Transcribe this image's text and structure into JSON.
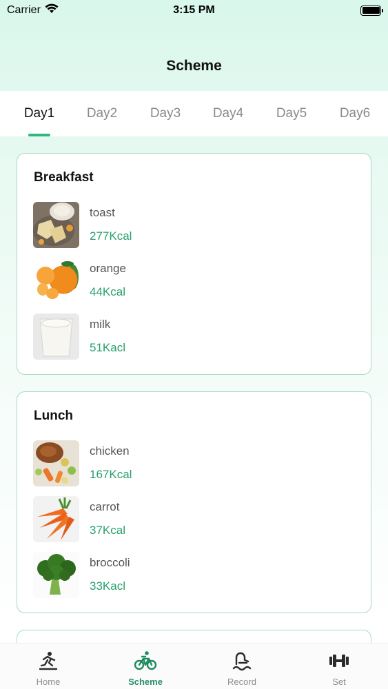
{
  "status_bar": {
    "carrier": "Carrier",
    "time": "3:15 PM"
  },
  "nav": {
    "title": "Scheme"
  },
  "day_tabs": [
    {
      "label": "Day1",
      "active": true
    },
    {
      "label": "Day2",
      "active": false
    },
    {
      "label": "Day3",
      "active": false
    },
    {
      "label": "Day4",
      "active": false
    },
    {
      "label": "Day5",
      "active": false
    },
    {
      "label": "Day6",
      "active": false
    }
  ],
  "meals": [
    {
      "title": "Breakfast",
      "items": [
        {
          "name": "toast",
          "kcal": "277Kcal",
          "image": "toast-photo"
        },
        {
          "name": "orange",
          "kcal": "44Kcal",
          "image": "orange-photo"
        },
        {
          "name": "milk",
          "kcal": "51Kacl",
          "image": "milk-photo"
        }
      ]
    },
    {
      "title": "Lunch",
      "items": [
        {
          "name": "chicken",
          "kcal": "167Kcal",
          "image": "chicken-photo"
        },
        {
          "name": "carrot",
          "kcal": "37Kcal",
          "image": "carrot-photo"
        },
        {
          "name": "broccoli",
          "kcal": "33Kacl",
          "image": "broccoli-photo"
        }
      ]
    }
  ],
  "tabbar": {
    "items": [
      {
        "label": "Home",
        "icon": "runner-icon",
        "active": false
      },
      {
        "label": "Scheme",
        "icon": "bicycle-icon",
        "active": true
      },
      {
        "label": "Record",
        "icon": "swimmer-icon",
        "active": false
      },
      {
        "label": "Set",
        "icon": "dumbbell-icon",
        "active": false
      }
    ]
  },
  "colors": {
    "accent": "#2db87f",
    "kcal_text": "#27a06c",
    "card_border": "#a9d9c6",
    "header_bg": "#d9f7ec"
  }
}
